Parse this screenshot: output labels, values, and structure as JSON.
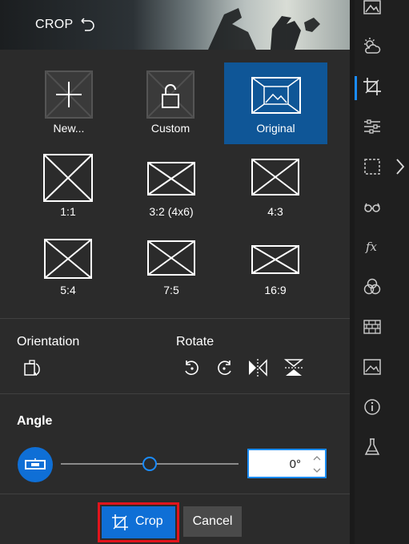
{
  "header": {
    "title": "CROP"
  },
  "aspect_ratios": [
    {
      "label": "New..."
    },
    {
      "label": "Custom"
    },
    {
      "label": "Original"
    },
    {
      "label": "1:1"
    },
    {
      "label": "3:2 (4x6)"
    },
    {
      "label": "4:3"
    },
    {
      "label": "5:4"
    },
    {
      "label": "7:5"
    },
    {
      "label": "16:9"
    }
  ],
  "selected_aspect": "Original",
  "orientation": {
    "label": "Orientation"
  },
  "rotate": {
    "label": "Rotate"
  },
  "angle": {
    "label": "Angle",
    "value": "0°",
    "slider_fraction": 0.5
  },
  "buttons": {
    "crop": "Crop",
    "cancel": "Cancel"
  },
  "sidebar": {
    "items": [
      "landscape-photos-icon",
      "weather-icon",
      "crop-icon",
      "adjust-sliders-icon",
      "selection-icon",
      "glasses-icon",
      "fx-icon",
      "color-circles-icon",
      "texture-icon",
      "image-icon",
      "info-icon",
      "flask-icon"
    ],
    "active": "crop-icon"
  },
  "colors": {
    "accent": "#0f6fd6",
    "highlight": "#e2141c",
    "selected_tile": "#0f5697",
    "panel": "#2b2b2b"
  }
}
